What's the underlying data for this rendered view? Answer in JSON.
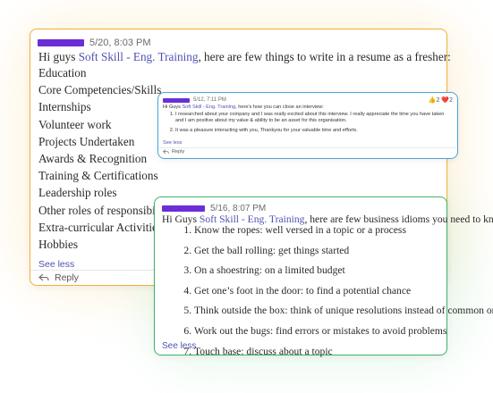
{
  "colors": {
    "card1_border": "#f2b03a",
    "card2_border": "#4aa3dc",
    "card3_border": "#3fb36b",
    "link": "#4f52b2",
    "name_highlight": "#6b2ed6"
  },
  "card1": {
    "timestamp": "5/20, 8:03 PM",
    "intro_prefix": "Hi guys ",
    "intro_link": "Soft Skill - Eng. Training",
    "intro_suffix": ", here are few things to write in a resume as a fresher:",
    "items": [
      "Education",
      "Core Competencies/Skills",
      "Internships",
      "Volunteer work",
      "Projects Undertaken",
      "Awards & Recognition",
      "Training & Certifications",
      "Leadership roles",
      "Other roles of responsibility",
      "Extra-curricular Activities",
      "Hobbies"
    ],
    "see_less": "See less",
    "reply": "Reply"
  },
  "card2": {
    "timestamp": "5/12, 7:11 PM",
    "reactions": "👍2 ❤️2",
    "intro_prefix": "Hi Guys ",
    "intro_link": "Soft Skill - Eng. Training",
    "intro_suffix": ", here's how you can close an interview:",
    "items": [
      "I researched about your company and I was really excited about this interview. I really appreciate the time you have taken and I am positive about my value & ability to be an asset for this organisation.",
      "It was a pleasure interacting with you, Thankyou for your valuable time and efforts."
    ],
    "see_less": "See less",
    "reply": "Reply"
  },
  "card3": {
    "timestamp": "5/16, 8:07 PM",
    "intro_prefix": "Hi Guys ",
    "intro_link": "Soft Skill - Eng. Training",
    "intro_suffix": ", here are few business idioms you need to know",
    "items": [
      "Know the ropes: well versed in a topic or a process",
      "Get the ball rolling: get things started",
      "On a shoestring: on a limited budget",
      "Get one’s foot in the door: to find a potential chance",
      "Think outside the box: think of unique resolutions instead of common ones",
      "Work out the bugs: find errors or mistakes to avoid problems",
      "Touch base: discuss about a topic"
    ],
    "see_less": "See less"
  }
}
